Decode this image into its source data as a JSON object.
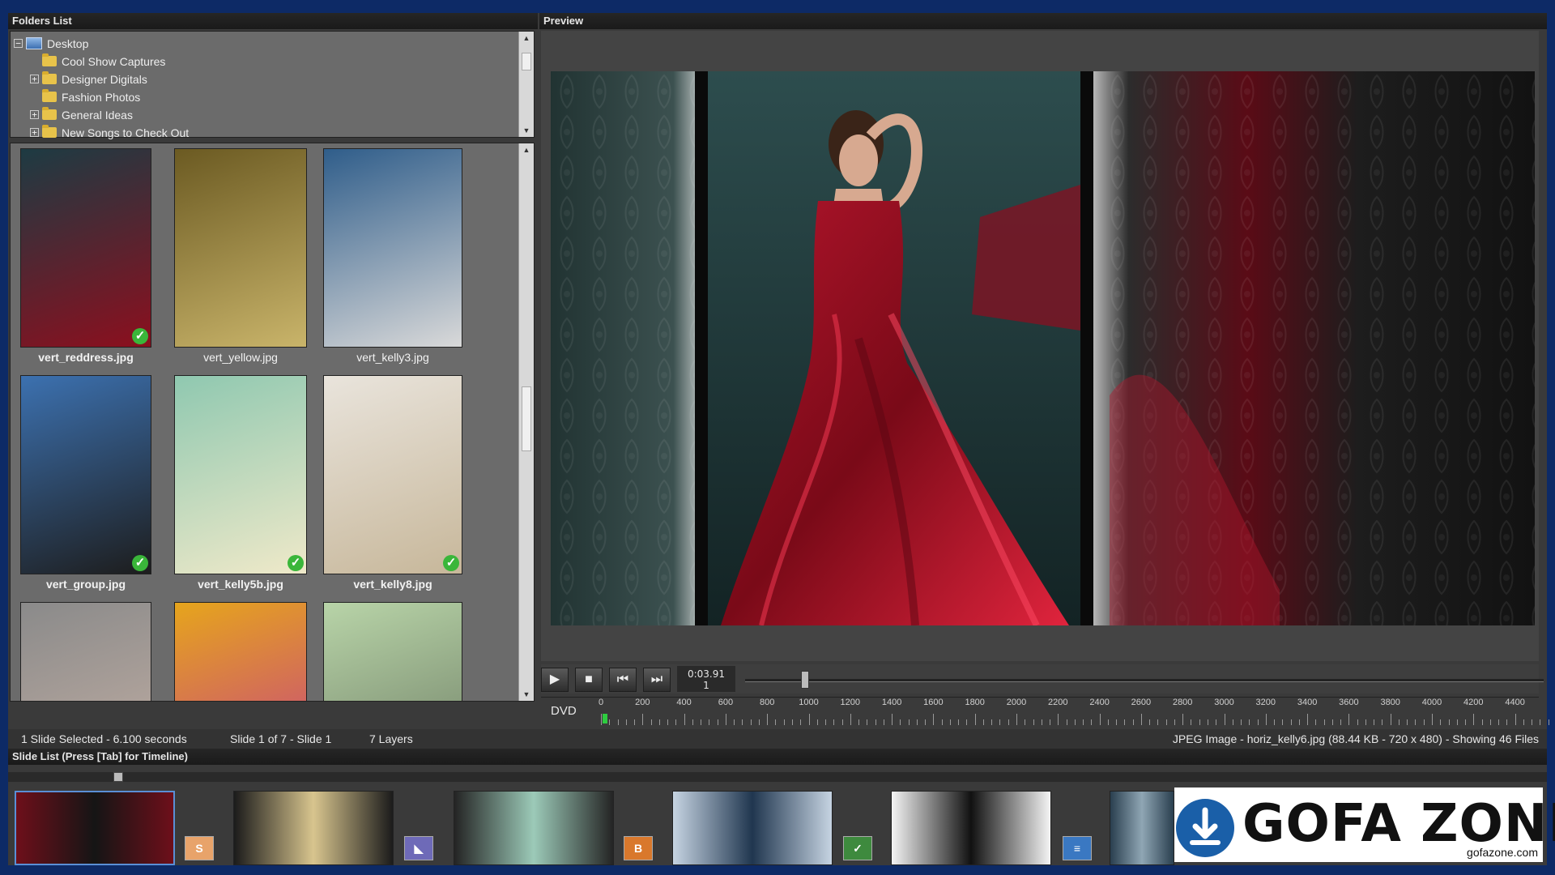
{
  "folders_panel": {
    "title": "Folders List"
  },
  "folder_tree": [
    {
      "label": "Desktop",
      "expander": "−",
      "icon": "desktop-icon"
    },
    {
      "label": "Cool Show Captures",
      "expander": "",
      "icon": "folder-icon"
    },
    {
      "label": "Designer Digitals",
      "expander": "+",
      "icon": "folder-icon"
    },
    {
      "label": "Fashion Photos",
      "expander": "",
      "icon": "folder-icon"
    },
    {
      "label": "General Ideas",
      "expander": "+",
      "icon": "folder-icon"
    },
    {
      "label": "New Songs to Check Out",
      "expander": "+",
      "icon": "folder-icon"
    }
  ],
  "thumbnails": [
    {
      "label": "vert_reddress.jpg",
      "checked": true,
      "selected": true,
      "colors": [
        "#1d3b43",
        "#8c0f1e"
      ]
    },
    {
      "label": "vert_yellow.jpg",
      "checked": false,
      "selected": false,
      "colors": [
        "#6b5a22",
        "#c9b46a"
      ]
    },
    {
      "label": "vert_kelly3.jpg",
      "checked": false,
      "selected": false,
      "colors": [
        "#2f5d8a",
        "#d9d9d9"
      ]
    },
    {
      "label": "vert_group.jpg",
      "checked": true,
      "selected": true,
      "colors": [
        "#3c71b0",
        "#1d1d1d"
      ]
    },
    {
      "label": "vert_kelly5b.jpg",
      "checked": true,
      "selected": true,
      "colors": [
        "#8fc8b0",
        "#efe9c9"
      ]
    },
    {
      "label": "vert_kelly8.jpg",
      "checked": true,
      "selected": true,
      "colors": [
        "#e9e4dc",
        "#c7b79a"
      ]
    },
    {
      "label": "",
      "checked": false,
      "selected": false,
      "colors": [
        "#8a8a8a",
        "#c7b2a6"
      ]
    },
    {
      "label": "",
      "checked": false,
      "selected": false,
      "colors": [
        "#e6a51c",
        "#c23a8d"
      ]
    },
    {
      "label": "",
      "checked": false,
      "selected": false,
      "colors": [
        "#b8d4a8",
        "#6b7a62"
      ]
    }
  ],
  "preview_panel": {
    "title": "Preview"
  },
  "transport": {
    "play_icon": "play-icon",
    "stop_icon": "stop-icon",
    "prev_icon": "skip-back-icon",
    "next_icon": "skip-forward-icon",
    "time": "0:03.91",
    "slide_num": "1",
    "position_fraction": 0.07
  },
  "ruler": {
    "format_label": "DVD",
    "ticks": [
      "0",
      "200",
      "400",
      "600",
      "800",
      "1000",
      "1200",
      "1400",
      "1600",
      "1800",
      "2000",
      "2200",
      "2400",
      "2600",
      "2800",
      "3000",
      "3200",
      "3400",
      "3600",
      "3800",
      "4000",
      "4200",
      "4400"
    ]
  },
  "status": {
    "selection": "1 Slide Selected - 6.100 seconds",
    "slide_position": "Slide 1 of 7 - Slide 1",
    "layers": "7 Layers",
    "file_info": "JPEG Image - horiz_kelly6.jpg (88.44 KB - 720 x 480) - Showing 46 Files"
  },
  "slide_list": {
    "title": "Slide List (Press [Tab] for Timeline)"
  },
  "slides": [
    {
      "colors": [
        "#6e0f1a",
        "#151515"
      ]
    },
    {
      "colors": [
        "#1b1b1b",
        "#d8c58e"
      ]
    },
    {
      "colors": [
        "#242424",
        "#9ccab8"
      ]
    },
    {
      "colors": [
        "#c6d4e2",
        "#20364f"
      ]
    },
    {
      "colors": [
        "#f4f4f4",
        "#111111"
      ]
    },
    {
      "colors": [
        "#2a3f4f",
        "#8fa6b4"
      ]
    }
  ],
  "transitions": [
    {
      "glyph": "S",
      "color": "#e8a36a"
    },
    {
      "glyph": "◣",
      "color": "#6e6ab8"
    },
    {
      "glyph": "B",
      "color": "#d9782c"
    },
    {
      "glyph": "✓",
      "color": "#3e8a3e"
    },
    {
      "glyph": "≡",
      "color": "#3a78c2"
    }
  ],
  "watermark": {
    "text": "GOFA ZONE",
    "url": "gofazone.com",
    "icon": "download-icon",
    "color": "#1a5fa8"
  }
}
